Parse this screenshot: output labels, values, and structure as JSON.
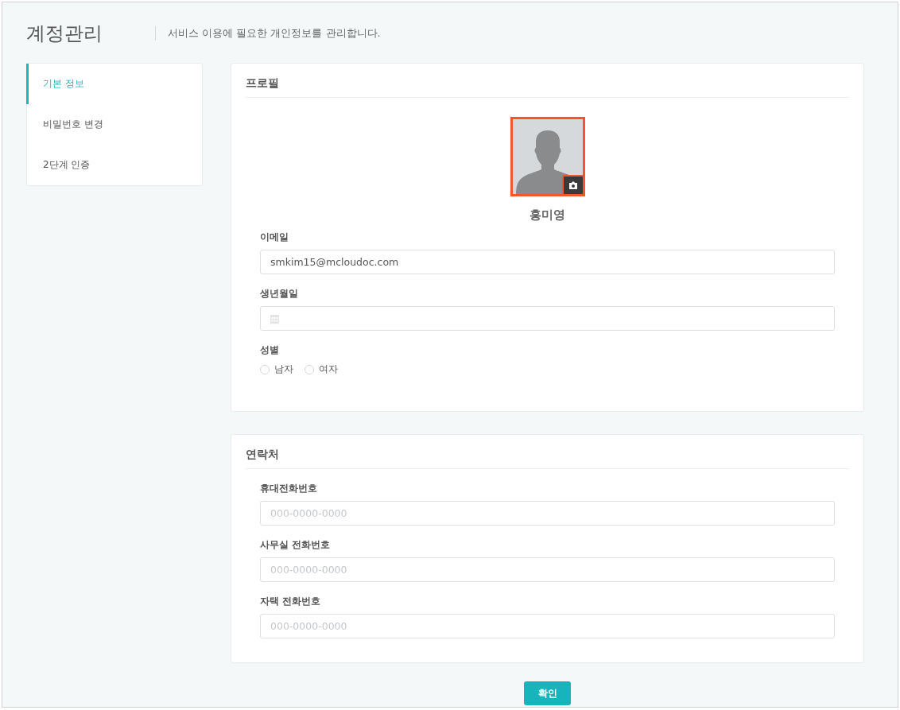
{
  "page": {
    "title": "계정관리",
    "subtitle": "서비스 이용에 필요한 개인정보를 관리합니다."
  },
  "sidebar": {
    "items": [
      {
        "label": "기본 정보",
        "selected": true
      },
      {
        "label": "비밀번호 변경",
        "selected": false
      },
      {
        "label": "2단계 인증",
        "selected": false
      }
    ]
  },
  "profile": {
    "heading": "프로필",
    "name": "홍미영",
    "fields": [
      {
        "kind": "text",
        "label": "이메일",
        "value": "smkim15@mcloudoc.com"
      },
      {
        "kind": "date",
        "label": "생년월일"
      },
      {
        "kind": "radio",
        "label": "성별",
        "options": [
          {
            "label": "남자",
            "selected": false
          },
          {
            "label": "여자",
            "selected": false
          }
        ]
      }
    ]
  },
  "contact": {
    "heading": "연락처",
    "fields": [
      {
        "kind": "text",
        "label": "휴대전화번호",
        "placeholder": "000-0000-0000"
      },
      {
        "kind": "text",
        "label": "사무실 전화번호",
        "placeholder": "000-0000-0000"
      },
      {
        "kind": "text",
        "label": "자택 전화번호",
        "placeholder": "000-0000-0000"
      }
    ]
  },
  "confirm_button": "확인"
}
